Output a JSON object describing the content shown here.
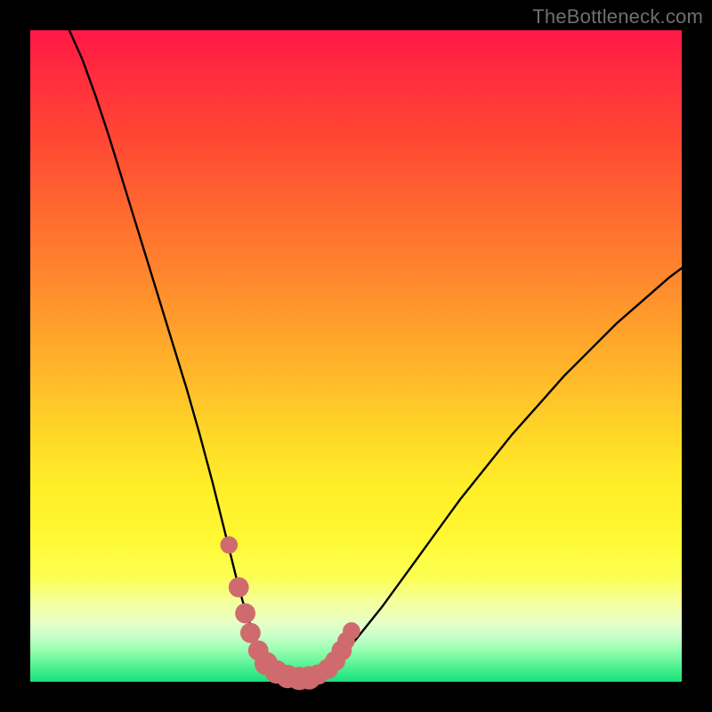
{
  "watermark": "TheBottleneck.com",
  "colors": {
    "background": "#000000",
    "curve": "#000000",
    "markers": "#cf6b6e"
  },
  "chart_data": {
    "type": "line",
    "title": "",
    "xlabel": "",
    "ylabel": "",
    "xlim": [
      0,
      100
    ],
    "ylim": [
      0,
      100
    ],
    "grid": false,
    "curve": {
      "x": [
        6,
        8,
        10,
        12,
        14,
        16,
        18,
        20,
        22,
        24,
        26,
        28,
        30,
        31,
        32,
        33,
        34,
        35,
        36,
        37,
        38,
        40,
        42,
        44,
        46,
        48,
        50,
        54,
        58,
        62,
        66,
        70,
        74,
        78,
        82,
        86,
        90,
        94,
        98,
        100
      ],
      "y": [
        100,
        95.5,
        90,
        84,
        77.5,
        71,
        64.5,
        58,
        51.5,
        45,
        38,
        30.5,
        22.5,
        18.5,
        14.5,
        11,
        8,
        5.5,
        3.5,
        2.2,
        1.2,
        0.5,
        0.5,
        1.0,
        2.3,
        4.2,
        6.5,
        11.5,
        17,
        22.5,
        28,
        33,
        38,
        42.5,
        47,
        51,
        55,
        58.5,
        62,
        63.5
      ]
    },
    "markers": [
      {
        "x": 30.5,
        "y": 21.0,
        "r": 1.2
      },
      {
        "x": 32.0,
        "y": 14.5,
        "r": 1.6
      },
      {
        "x": 33.0,
        "y": 10.5,
        "r": 1.6
      },
      {
        "x": 33.8,
        "y": 7.5,
        "r": 1.6
      },
      {
        "x": 35.0,
        "y": 4.8,
        "r": 1.6
      },
      {
        "x": 36.2,
        "y": 2.8,
        "r": 2.0
      },
      {
        "x": 37.8,
        "y": 1.5,
        "r": 2.0
      },
      {
        "x": 39.5,
        "y": 0.8,
        "r": 2.0
      },
      {
        "x": 41.3,
        "y": 0.5,
        "r": 2.0
      },
      {
        "x": 42.8,
        "y": 0.6,
        "r": 2.0
      },
      {
        "x": 44.2,
        "y": 1.1,
        "r": 1.6
      },
      {
        "x": 45.7,
        "y": 2.0,
        "r": 1.6
      },
      {
        "x": 46.8,
        "y": 3.2,
        "r": 1.6
      },
      {
        "x": 47.8,
        "y": 4.8,
        "r": 1.6
      },
      {
        "x": 48.5,
        "y": 6.3,
        "r": 1.2
      },
      {
        "x": 49.3,
        "y": 7.8,
        "r": 1.2
      }
    ]
  }
}
